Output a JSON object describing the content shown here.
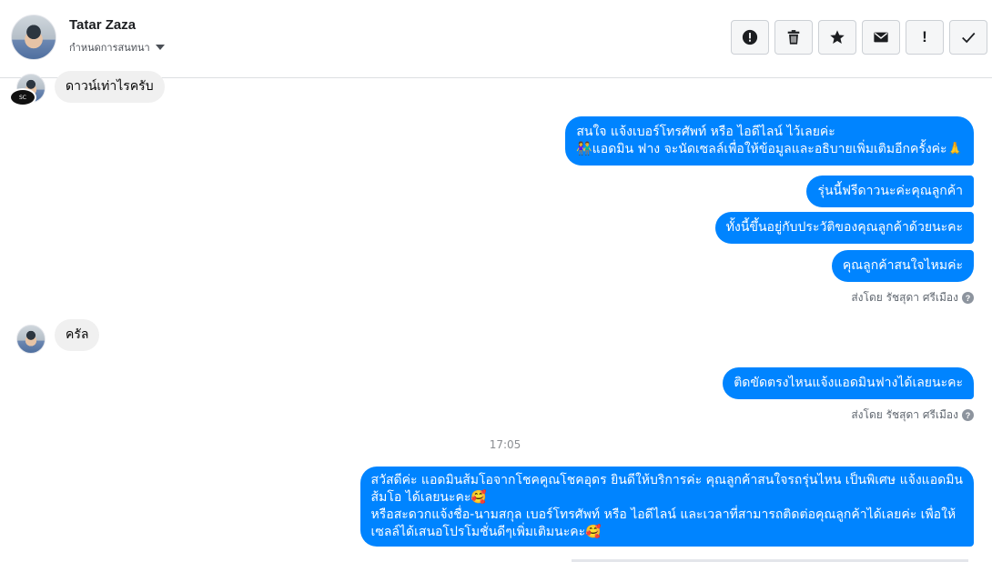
{
  "header": {
    "contact_name": "Tatar Zaza",
    "assign_label": "กำหนดการสนทนา",
    "actions": [
      {
        "name": "report-spam",
        "icon": "alert-circle-icon"
      },
      {
        "name": "delete",
        "icon": "trash-icon"
      },
      {
        "name": "star",
        "icon": "star-icon"
      },
      {
        "name": "mark-unread",
        "icon": "envelope-icon"
      },
      {
        "name": "mark-important",
        "icon": "exclamation-icon",
        "glyph": "!"
      },
      {
        "name": "mark-done",
        "icon": "check-icon"
      }
    ]
  },
  "messages": [
    {
      "dir": "in",
      "text": "ดาวน์เท่าไรครับ"
    },
    {
      "dir": "out",
      "lines": [
        "สนใจ แจ้งเบอร์โทรศัพท์ หรือ ไอดีไลน์  ไว้เลยค่ะ",
        "👫แอดมิน ฟาง จะนัดเซลล์เพื่อให้ข้อมูลและอธิบายเพิ่มเติมอีกครั้งค่ะ🙏"
      ]
    },
    {
      "dir": "out",
      "text": "รุ่นนี้ฟรีดาวนะค่ะคุณลูกค้า"
    },
    {
      "dir": "out",
      "text": "ทั้งนี้ขึ้นอยู่กับประวัติของคุณลูกค้าด้วยนะคะ"
    },
    {
      "dir": "out",
      "text": "คุณลูกค้าสนใจไหมค่ะ"
    },
    {
      "dir": "meta",
      "text": "ส่งโดย รัชสุดา ศรีเมือง"
    },
    {
      "dir": "in",
      "text": "ครัล"
    },
    {
      "dir": "out",
      "text": "ติดขัดตรงไหนแจ้งแอดมินฟางได้เลยนะคะ"
    },
    {
      "dir": "meta",
      "text": "ส่งโดย รัชสุดา ศรีเมือง"
    },
    {
      "dir": "time",
      "text": "17:05"
    },
    {
      "dir": "out",
      "lines": [
        "สวัสดีค่ะ แอดมินส้มโอจากโชคคูณโชคอุดร ยินดีให้บริการค่ะ   คุณลูกค้าสนใจรถรุ่นไหน เป็นพิเศษ แจ้งแอดมิน",
        "ส้มโอ ได้เลยนะคะ🥰",
        "หรือสะดวกแจ้งชื่อ-นามสกุล เบอร์โทรศัพท์ หรือ ไอดีไลน์ และเวลาที่สามารถติดต่อคุณลูกค้าได้เลยค่ะ เพื่อให้",
        "เซลล์ได้เสนอโปรโมชั่นดีๆเพิ่มเติมนะคะ🥰"
      ]
    }
  ],
  "colors": {
    "outgoing": "#0084ff",
    "incoming": "#f0f0f0",
    "meta": "#606770"
  }
}
